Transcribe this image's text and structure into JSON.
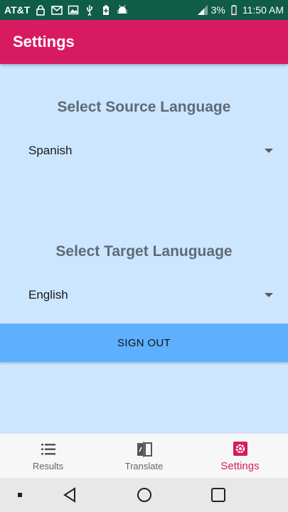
{
  "status_bar": {
    "carrier": "AT&T",
    "battery_percent": "3%",
    "time": "11:50 AM",
    "icons": [
      "lock-icon",
      "gmail-icon",
      "image-icon",
      "usb-icon",
      "battery-saver-icon",
      "android-debug-icon"
    ]
  },
  "app_bar": {
    "title": "Settings"
  },
  "source": {
    "heading": "Select Source Language",
    "selected": "Spanish"
  },
  "target": {
    "heading": "Select Target Lanuguage",
    "selected": "English"
  },
  "sign_out_label": "SIGN OUT",
  "bottom_nav": {
    "items": [
      {
        "label": "Results",
        "icon": "list-icon",
        "active": false
      },
      {
        "label": "Translate",
        "icon": "translate-icon",
        "active": false
      },
      {
        "label": "Settings",
        "icon": "settings-icon",
        "active": true
      }
    ]
  },
  "colors": {
    "status_bar": "#0f5c47",
    "app_bar": "#d81b60",
    "background": "#cce6ff",
    "button": "#5eb0ff",
    "accent": "#d81b60"
  }
}
